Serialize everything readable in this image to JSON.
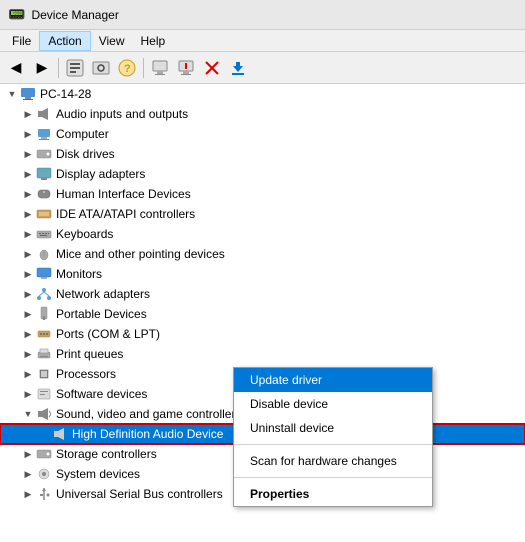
{
  "titleBar": {
    "icon": "📟",
    "title": "Device Manager"
  },
  "menuBar": {
    "items": [
      "File",
      "Action",
      "View",
      "Help"
    ]
  },
  "toolbar": {
    "buttons": [
      "◀",
      "▶",
      "🖥",
      "📋",
      "❓",
      "🖥",
      "🖥",
      "✖",
      "⬇"
    ]
  },
  "tree": {
    "root": "PC-14-28",
    "items": [
      {
        "label": "Audio inputs and outputs",
        "indent": 2,
        "icon": "audio"
      },
      {
        "label": "Computer",
        "indent": 2,
        "icon": "computer"
      },
      {
        "label": "Disk drives",
        "indent": 2,
        "icon": "disk"
      },
      {
        "label": "Display adapters",
        "indent": 2,
        "icon": "display"
      },
      {
        "label": "Human Interface Devices",
        "indent": 2,
        "icon": "hid"
      },
      {
        "label": "IDE ATA/ATAPI controllers",
        "indent": 2,
        "icon": "ide"
      },
      {
        "label": "Keyboards",
        "indent": 2,
        "icon": "keyboard"
      },
      {
        "label": "Mice and other pointing devices",
        "indent": 2,
        "icon": "mouse"
      },
      {
        "label": "Monitors",
        "indent": 2,
        "icon": "monitor"
      },
      {
        "label": "Network adapters",
        "indent": 2,
        "icon": "network"
      },
      {
        "label": "Portable Devices",
        "indent": 2,
        "icon": "portable"
      },
      {
        "label": "Ports (COM & LPT)",
        "indent": 2,
        "icon": "ports"
      },
      {
        "label": "Print queues",
        "indent": 2,
        "icon": "print"
      },
      {
        "label": "Processors",
        "indent": 2,
        "icon": "processor"
      },
      {
        "label": "Software devices",
        "indent": 2,
        "icon": "software"
      },
      {
        "label": "Sound, video and game controllers",
        "indent": 2,
        "icon": "sound",
        "expanded": true
      },
      {
        "label": "High Definition Audio Device",
        "indent": 3,
        "icon": "audio-device",
        "selected": true
      },
      {
        "label": "Storage controllers",
        "indent": 2,
        "icon": "storage"
      },
      {
        "label": "System devices",
        "indent": 2,
        "icon": "system"
      },
      {
        "label": "Universal Serial Bus controllers",
        "indent": 2,
        "icon": "usb"
      }
    ]
  },
  "contextMenu": {
    "items": [
      {
        "label": "Update driver",
        "active": true
      },
      {
        "label": "Disable device"
      },
      {
        "label": "Uninstall device"
      },
      {
        "separator": true
      },
      {
        "label": "Scan for hardware changes"
      },
      {
        "separator": true
      },
      {
        "label": "Properties",
        "bold": true
      }
    ]
  }
}
